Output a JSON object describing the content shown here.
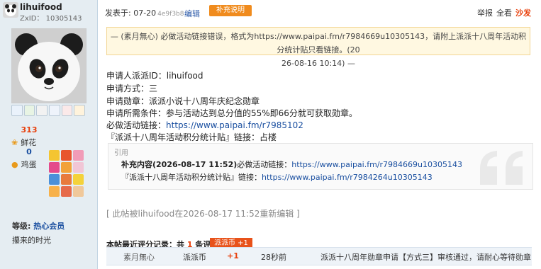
{
  "user": {
    "name": "lihuifood",
    "zxid": "ZxID： 10305143",
    "stats": [
      {
        "value": "313",
        "label": "鲜花",
        "color": "#e8400c"
      },
      {
        "value": "0",
        "label": "鸡蛋",
        "color": "#1a4fa0"
      }
    ],
    "level_label": "等级:",
    "level_value": "热心会员",
    "shout": "攥来的时光"
  },
  "post": {
    "date": "发表于: 07-20",
    "hash": "4e9f3b8",
    "edit": "编辑",
    "supplement_button": "补充说明",
    "actions": {
      "report": "举报",
      "all": "全看",
      "sofa": "沙发"
    },
    "notice_line1": "— (素月無心) 必做活动链接错误，格式为https://www.paipai.fm/r7984669u10305143，请附上派派十八周年活动积分统计贴只看链接。(20",
    "notice_line2": "26-08-16 10:14) —",
    "lines": [
      "申请人派派ID：lihuifood",
      "申请方式：三",
      "申请勋章：派派小说十八周年庆纪念勋章",
      "申请所需条件：参与活动达到总分值的55%即66分就可获取勋章。"
    ],
    "must_label": "必做活动链接：",
    "must_link": "https://www.paipai.fm/r7985102",
    "stats_line": "『派派十八周年活动积分统计贴』链接：占楼",
    "quote": {
      "label": "引用",
      "l1_prefix": "补充内容(2026-08-17 11:52)",
      "l1_text": "必做活动链接：",
      "l1_link": "https://www.paipai.fm/r7984669u10305143",
      "l2_text": "『派派十八周年活动积分统计贴』链接：",
      "l2_link": "https://www.paipai.fm/r7984264u10305143"
    },
    "reedit": "[ 此帖被lihuifood在2026-08-17 11:52重新编辑 ]"
  },
  "rating": {
    "title_prefix": "本帖最近评分记录：共",
    "count": "1",
    "title_suffix": "条评分",
    "badge": "派派币 +1",
    "row": {
      "user": "素月無心",
      "type": "派派币",
      "delta": "+1",
      "time": "28秒前",
      "reason": "派派十八周年勋章申请【方式三】审核通过，请耐心等待勋章"
    }
  }
}
